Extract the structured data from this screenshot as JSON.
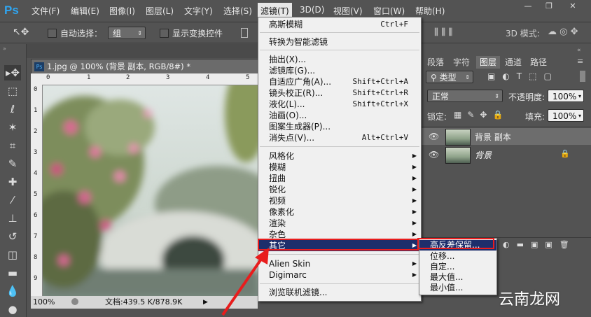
{
  "app": {
    "logo": "Ps"
  },
  "menubar": {
    "items": [
      "文件(F)",
      "编辑(E)",
      "图像(I)",
      "图层(L)",
      "文字(Y)",
      "选择(S)",
      "滤镜(T)",
      "3D(D)",
      "视图(V)",
      "窗口(W)",
      "帮助(H)"
    ],
    "active": "滤镜(T)"
  },
  "options": {
    "auto_select_label": "自动选择：",
    "auto_select_value": "组",
    "show_transform_label": "显示变换控件",
    "mode_3d_label": "3D 模式:"
  },
  "document": {
    "tab_title": "1.jpg @ 100% (背景 副本, RGB/8#) *",
    "ruler_top": [
      "0",
      "1",
      "2",
      "3",
      "4",
      "5"
    ],
    "ruler_left": [
      "0",
      "1",
      "2",
      "3",
      "4",
      "5",
      "6",
      "7",
      "8",
      "9"
    ],
    "zoom": "100%",
    "doc_info": "文档:439.5 K/878.9K"
  },
  "panels": {
    "tabs": [
      "段落",
      "字符",
      "图层",
      "通道",
      "路径"
    ],
    "active_tab": "图层",
    "kind_label": "类型",
    "blend_mode": "正常",
    "opacity_label": "不透明度:",
    "opacity_value": "100%",
    "lock_label": "锁定:",
    "fill_label": "填充:",
    "fill_value": "100%",
    "layers": [
      {
        "name": "背景 副本",
        "selected": true
      },
      {
        "name": "背景",
        "selected": false
      }
    ]
  },
  "filter_menu": {
    "items": [
      {
        "label": "高斯模糊",
        "shortcut": "Ctrl+F"
      },
      {
        "label": "转换为智能滤镜"
      },
      {
        "label": "抽出(X)..."
      },
      {
        "label": "滤镜库(G)..."
      },
      {
        "label": "自适应广角(A)...",
        "shortcut": "Shift+Ctrl+A"
      },
      {
        "label": "镜头校正(R)...",
        "shortcut": "Shift+Ctrl+R"
      },
      {
        "label": "液化(L)...",
        "shortcut": "Shift+Ctrl+X"
      },
      {
        "label": "油画(O)..."
      },
      {
        "label": "图案生成器(P)..."
      },
      {
        "label": "消失点(V)...",
        "shortcut": "Alt+Ctrl+V"
      },
      {
        "label": "风格化"
      },
      {
        "label": "模糊"
      },
      {
        "label": "扭曲"
      },
      {
        "label": "锐化"
      },
      {
        "label": "视频"
      },
      {
        "label": "像素化"
      },
      {
        "label": "渲染"
      },
      {
        "label": "杂色"
      },
      {
        "label": "其它"
      },
      {
        "label": "Alien Skin"
      },
      {
        "label": "Digimarc"
      },
      {
        "label": "浏览联机滤镜..."
      }
    ]
  },
  "other_submenu": {
    "items": [
      "高反差保留...",
      "位移...",
      "自定...",
      "最大值...",
      "最小值..."
    ],
    "highlighted": "高反差保留..."
  },
  "watermark": "云南龙网",
  "colors": {
    "menu_highlight": "#1e2e6b",
    "annotation_red": "#e81d1d",
    "ps_blue": "#2fa6f2"
  }
}
